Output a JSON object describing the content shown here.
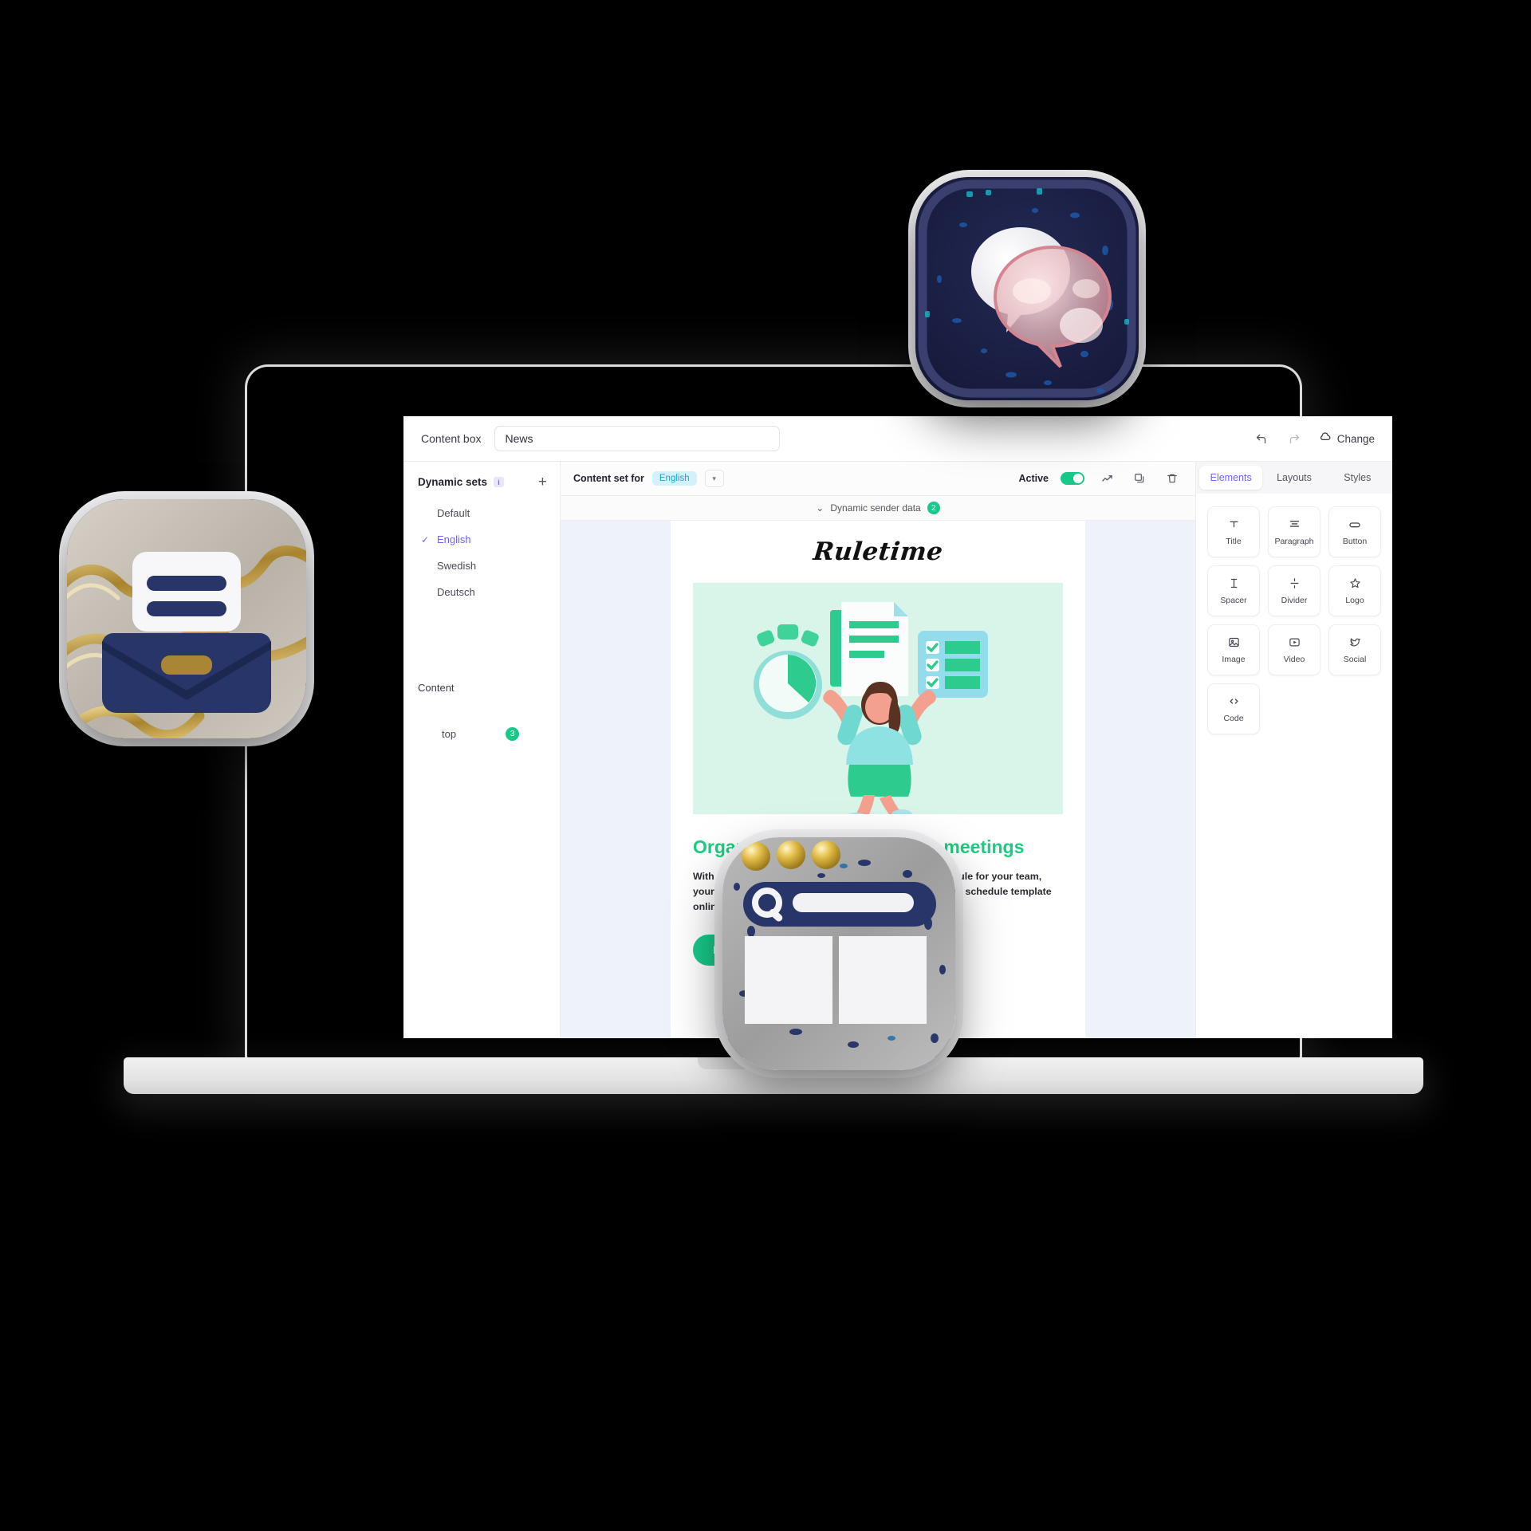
{
  "app": {
    "topbar": {
      "content_box_label": "Content box",
      "content_box_value": "News",
      "undo_icon": "undo-icon",
      "redo_icon": "redo-icon",
      "cloud_icon": "cloud-icon",
      "change_label": "Change"
    },
    "sidebar": {
      "title": "Dynamic sets",
      "info_icon": "info-icon",
      "add_icon": "plus-icon",
      "items": [
        {
          "label": "Default",
          "selected": false
        },
        {
          "label": "English",
          "selected": true
        },
        {
          "label": "Swedish",
          "selected": false
        },
        {
          "label": "Deutsch",
          "selected": false
        }
      ],
      "section_label": "Content",
      "sub_label": "top",
      "sub_badge": "3"
    },
    "contentset": {
      "label": "Content set for",
      "value": "English",
      "dropdown_icon": "chevron-down-icon",
      "active_label": "Active",
      "toggle_on": true,
      "stats_icon": "trend-chart-icon",
      "duplicate_icon": "duplicate-icon",
      "delete_icon": "trash-icon"
    },
    "dynamic_sender": {
      "chevron_icon": "chevron-down-icon",
      "label": "Dynamic sender data",
      "badge": "2"
    },
    "email": {
      "logo": "Ruletime",
      "hero_alt": "celebration-illustration",
      "heading": "Organize and schedule your meetings",
      "paragraph": "With a schedule maker, you can create the perfect schedule for your team, your classroom or your family. You can easily publish the schedule template online and send it further to friends.",
      "cta": "Read more",
      "heading_color": "#19ce7f",
      "cta_color": "#18c98a",
      "hero_bg": "#d9f5ea"
    },
    "elements_panel": {
      "tabs": [
        {
          "label": "Elements",
          "active": true
        },
        {
          "label": "Layouts",
          "active": false
        },
        {
          "label": "Styles",
          "active": false
        }
      ],
      "tiles": [
        {
          "label": "Title",
          "icon": "title-icon"
        },
        {
          "label": "Paragraph",
          "icon": "paragraph-icon"
        },
        {
          "label": "Button",
          "icon": "button-icon"
        },
        {
          "label": "Spacer",
          "icon": "spacer-icon"
        },
        {
          "label": "Divider",
          "icon": "divider-icon"
        },
        {
          "label": "Logo",
          "icon": "star-logo-icon"
        },
        {
          "label": "Image",
          "icon": "image-icon"
        },
        {
          "label": "Video",
          "icon": "video-icon"
        },
        {
          "label": "Social",
          "icon": "social-icon"
        },
        {
          "label": "Code",
          "icon": "code-icon"
        }
      ]
    }
  },
  "floating_icons": [
    {
      "name": "chat-bubble-3d-icon",
      "bg": "#1c1f44"
    },
    {
      "name": "mail-envelope-3d-icon",
      "bg": "#bdb7ad"
    },
    {
      "name": "search-browser-3d-icon",
      "bg": "#a8a8a8"
    }
  ],
  "colors": {
    "background": "#000000",
    "accent_purple": "#6c63ff",
    "accent_green": "#18c98a",
    "chip_blue": "#14a8c9"
  }
}
